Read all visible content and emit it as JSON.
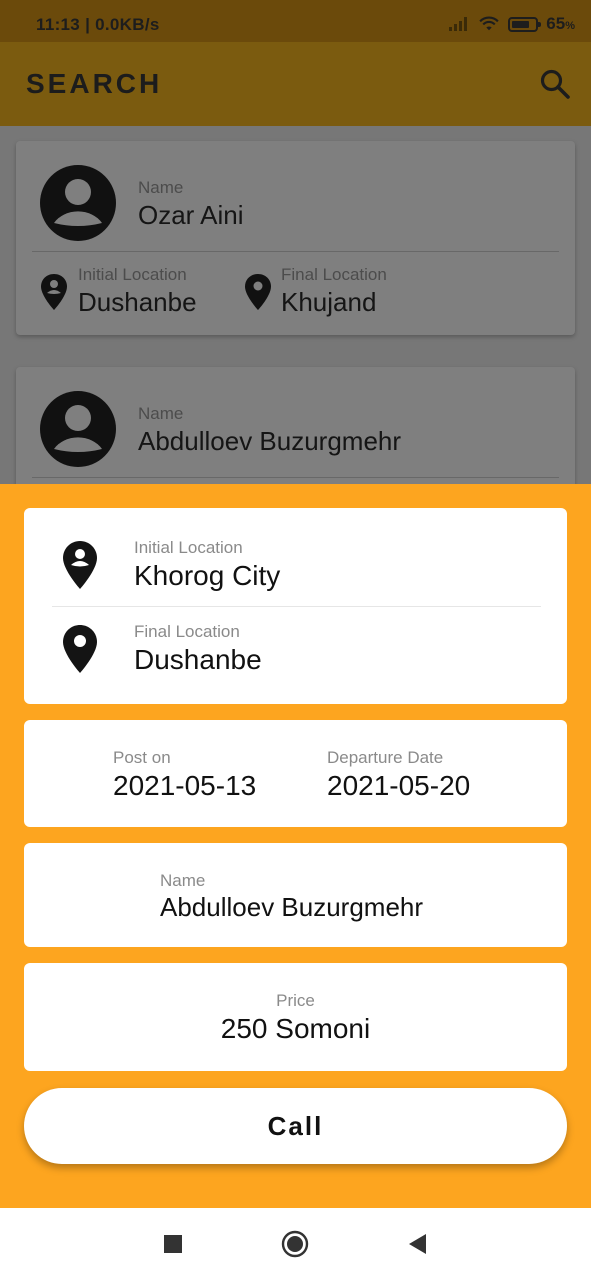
{
  "status_bar": {
    "time_speed": "11:13 | 0.0KB/s",
    "battery_text": "65",
    "battery_unit": "%",
    "battery_level": 0.65
  },
  "app_bar": {
    "title": "SEARCH",
    "search_icon": "search-icon"
  },
  "background_list": [
    {
      "name_label": "Name",
      "name": "Ozar Aini",
      "initial_label": "Initial Location",
      "initial": "Dushanbe",
      "final_label": "Final Location",
      "final": "Khujand"
    },
    {
      "name_label": "Name",
      "name": "Abdulloev Buzurgmehr"
    }
  ],
  "detail": {
    "initial_label": "Initial Location",
    "initial_value": "Khorog City",
    "final_label": "Final Location",
    "final_value": "Dushanbe",
    "posted_label": "Post on",
    "posted_value": "2021-05-13",
    "departure_label": "Departure Date",
    "departure_value": "2021-05-20",
    "name_label": "Name",
    "name_value": "Abdulloev Buzurgmehr",
    "price_label": "Price",
    "price_value": "250 Somoni",
    "call_label": "Call"
  },
  "colors": {
    "accent": "#fda51f",
    "status_bar_dim": "#6b4a0b",
    "app_bar_dim": "#7b5b0f"
  },
  "nav": {
    "icons": [
      "square-recents-icon",
      "circle-home-icon",
      "triangle-back-icon"
    ]
  }
}
